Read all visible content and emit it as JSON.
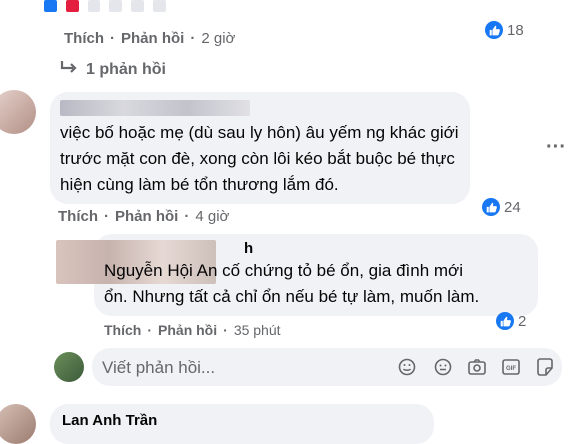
{
  "top_comment": {
    "actions": {
      "like": "Thích",
      "reply": "Phản hồi",
      "time": "2 giờ"
    },
    "reaction_count": "18",
    "replies_toggle": "1 phản hồi"
  },
  "reply1": {
    "text_lines": [
      "việc bố hoặc mẹ (dù sau ly hôn) âu yếm ng khác giới",
      "trước mặt con đè, xong còn lôi kéo bắt buộc bé thực",
      "hiện cùng làm bé tổn thương lắm đó."
    ],
    "actions": {
      "like": "Thích",
      "reply": "Phản hồi",
      "time": "4 giờ"
    },
    "reaction_count": "24",
    "more": "···"
  },
  "reply2": {
    "name_visible": "h",
    "text_lines": [
      "Nguyễn Hội An cố chứng tỏ bé ổn, gia đình mới",
      "ổn. Nhưng tất cả chỉ ổn nếu bé tự làm, muốn làm."
    ],
    "actions": {
      "like": "Thích",
      "reply": "Phản hồi",
      "time": "35 phút"
    },
    "reaction_count": "2"
  },
  "composer": {
    "placeholder": "Viết phản hồi..."
  },
  "next_comment": {
    "author": "Lan Anh Trần"
  },
  "colors": {
    "accent": "#1877f2",
    "bubble": "#f0f2f5",
    "meta": "#65676b"
  },
  "icons": [
    "like-icon",
    "reply-arrow-icon",
    "more-icon",
    "emoji-icon",
    "camera-icon",
    "gif-icon",
    "sticker-icon"
  ]
}
